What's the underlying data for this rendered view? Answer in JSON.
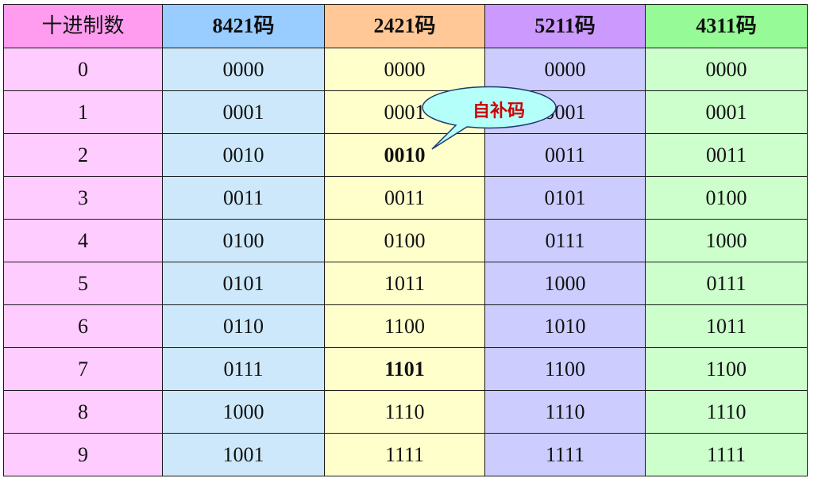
{
  "table": {
    "headers": [
      "十进制数",
      "8421码",
      "2421码",
      "5211码",
      "4311码"
    ],
    "rows": [
      [
        "0",
        "0000",
        "0000",
        "0000",
        "0000"
      ],
      [
        "1",
        "0001",
        "0001",
        "0001",
        "0001"
      ],
      [
        "2",
        "0010",
        "0010",
        "0011",
        "0011"
      ],
      [
        "3",
        "0011",
        "0011",
        "0101",
        "0100"
      ],
      [
        "4",
        "0100",
        "0100",
        "0111",
        "1000"
      ],
      [
        "5",
        "0101",
        "1011",
        "1000",
        "0111"
      ],
      [
        "6",
        "0110",
        "1100",
        "1010",
        "1011"
      ],
      [
        "7",
        "0111",
        "1101",
        "1100",
        "1100"
      ],
      [
        "8",
        "1000",
        "1110",
        "1110",
        "1110"
      ],
      [
        "9",
        "1001",
        "1111",
        "1111",
        "1111"
      ]
    ],
    "highlighted_cells": [
      "2-2421",
      "7-2421"
    ]
  },
  "callout": {
    "text": "自补码"
  },
  "colors": {
    "header": [
      "#ff9cf0",
      "#99ccff",
      "#ffc896",
      "#cc99ff",
      "#96fa96"
    ],
    "column": [
      "#ffccff",
      "#cce8fa",
      "#ffffcc",
      "#ccccff",
      "#ccffcc"
    ],
    "highlight_text": "#e00000",
    "callout_fill": "#b5fffa",
    "callout_text": "#cc0000"
  }
}
